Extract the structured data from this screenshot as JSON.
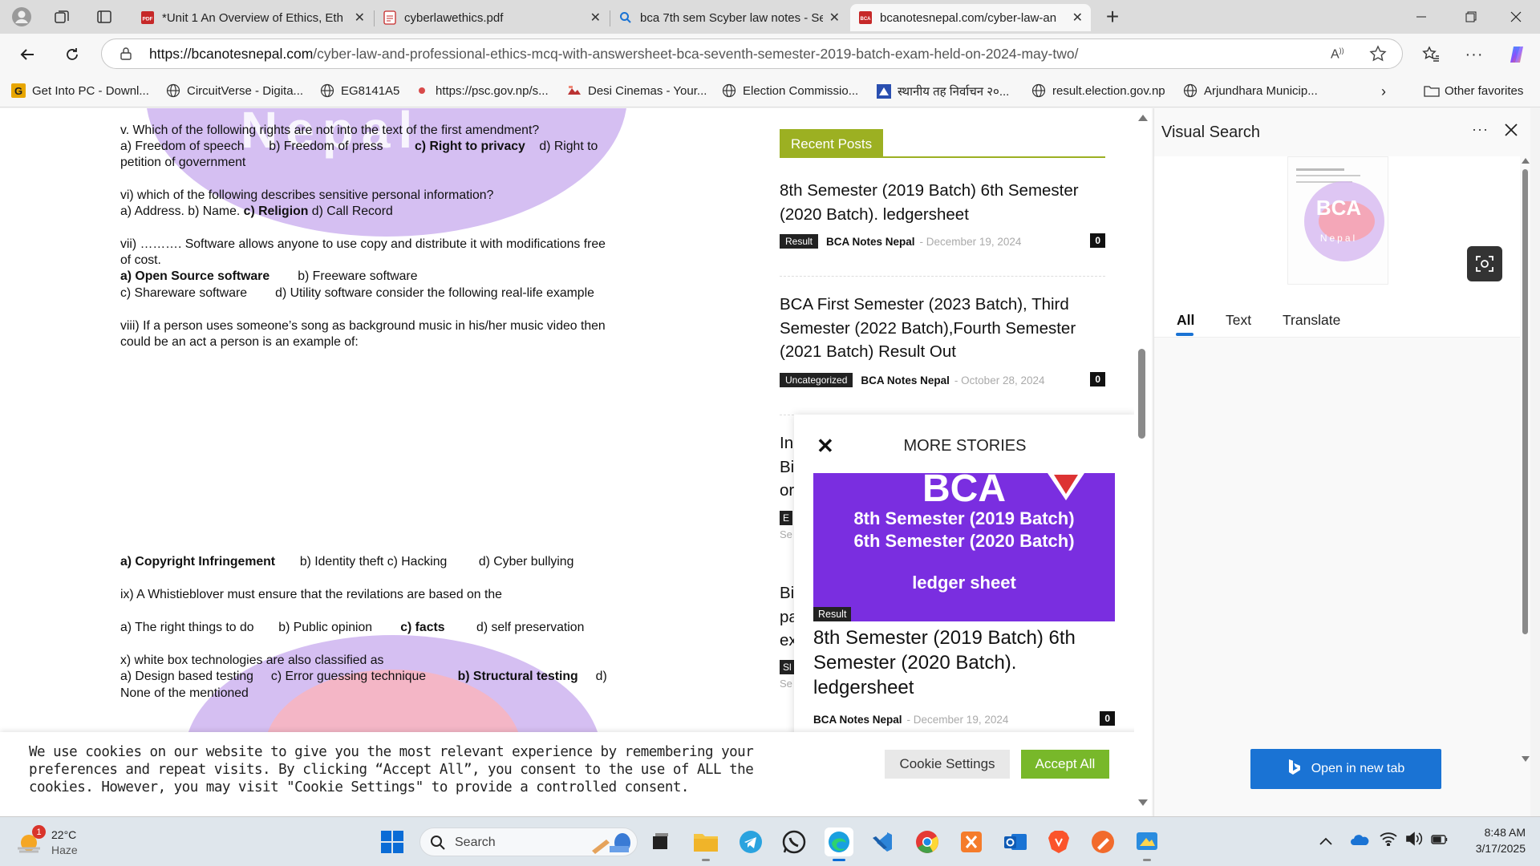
{
  "tabs": [
    {
      "title": "*Unit 1 An Overview of Ethics, Eth",
      "icon": "pdf-icon"
    },
    {
      "title": "cyberlawethics.pdf",
      "icon": "pdf-icon"
    },
    {
      "title": "bca 7th sem Scyber law notes - Se",
      "icon": "search-icon"
    },
    {
      "title": "bcanotesnepal.com/cyber-law-an",
      "icon": "site-icon",
      "active": true
    }
  ],
  "address_bar": {
    "url_domain": "https://bcanotesnepal.com",
    "url_path": "/cyber-law-and-professional-ethics-mcq-with-answersheet-bca-seventh-semester-2019-batch-exam-held-on-2024-may-two/"
  },
  "bookmarks": [
    "Get Into PC - Downl...",
    "CircuitVerse - Digita...",
    "EG8141A5",
    "https://psc.gov.np/s...",
    "Desi Cinemas - Your...",
    "Election Commissio...",
    "स्थानीय तह निर्वाचन २०...",
    "result.election.gov.np",
    "Arjundhara Municip..."
  ],
  "other_favorites": "Other favorites",
  "article": {
    "q5": {
      "q": "v. Which of the following rights are not into the text of the first amendment?",
      "a": "a) Freedom of speech",
      "b": "b) Freedom of press",
      "c": "c) Right to privacy",
      "d": "d) Right to",
      "cont": "petition of government"
    },
    "q6": {
      "q": "vi) which of the following describes sensitive personal information?",
      "a": "a) Address.  b) Name.",
      "c": "c) Religion",
      "d": "d) Call Record"
    },
    "q7": {
      "q": "vii) ………. Software allows anyone to use copy and distribute it with modifications free",
      "cont": "of cost.",
      "a": "a) Open Source software",
      "b": "b) Freeware software",
      "c": "c) Shareware software",
      "d": "d) Utility software consider the following real-life example"
    },
    "q8": {
      "q": "viii) If a person uses someone’s song as background music in his/her music video then",
      "cont": "could be an act a person is an example of:",
      "a": "a) Copyright Infringement",
      "b": "b) Identity theft",
      "c": "c) Hacking",
      "d": "d) Cyber bullying"
    },
    "q9": {
      "q": "ix) A Whistieblover must ensure that the revilations are based on the",
      "a": "a) The right things to do",
      "b": "b) Public opinion",
      "c": "c) facts",
      "d": "d) self preservation"
    },
    "q10": {
      "q": "x) white box technologies are also classified as",
      "a": "a) Design based testing",
      "b": "c) Error guessing technique",
      "c": "b) Structural testing",
      "d": "d)",
      "cont": "None of the mentioned"
    }
  },
  "sidebar": {
    "heading": "Recent Posts",
    "posts": [
      {
        "title": "8th Semester (2019 Batch) 6th Semester (2020 Batch). ledgersheet",
        "category": "Result",
        "author": "BCA Notes Nepal",
        "date": "December 19, 2024",
        "comments": "0"
      },
      {
        "title": "BCA First Semester (2023 Batch), Third Semester (2022 Batch),Fourth Semester (2021 Batch) Result Out",
        "category": "Uncategorized",
        "author": "BCA Notes Nepal",
        "date": "October 28, 2024",
        "comments": "0"
      }
    ],
    "partial": [
      "In",
      "Bi",
      "or",
      "E",
      "Se",
      "Bi",
      "pa",
      "ex",
      "Sl",
      "Se"
    ]
  },
  "more_stories": {
    "heading": "MORE STORIES",
    "image_lines": [
      "BCA",
      "8th Semester (2019 Batch)",
      "6th Semester (2020 Batch)",
      "ledger sheet"
    ],
    "category": "Result",
    "title": "8th Semester (2019 Batch) 6th Semester (2020 Batch). ledgersheet",
    "author": "BCA Notes Nepal",
    "date": "December 19, 2024",
    "comments": "0"
  },
  "cookie": {
    "text": "We use cookies on our website to give you the most relevant experience by remembering your preferences and repeat visits. By clicking “Accept All”, you consent to the use of ALL the cookies. However, you may visit \"Cookie Settings\" to provide a controlled consent.",
    "settings_label": "Cookie Settings",
    "accept_label": "Accept All"
  },
  "visual_search": {
    "title": "Visual Search",
    "tabs": [
      "All",
      "Text",
      "Translate"
    ],
    "thumb_text": [
      "BCA",
      "Nepal"
    ],
    "open_label": "Open in new tab"
  },
  "taskbar": {
    "weather_temp": "22°C",
    "weather_desc": "Haze",
    "weather_badge": "1",
    "search_placeholder": "Search",
    "time": "8:48 AM",
    "date": "3/17/2025"
  },
  "colors": {
    "accent_green": "#9cb022",
    "cookie_green": "#78b82a",
    "bing_blue": "#1a73d4",
    "purple_banner": "#7a2ee0"
  }
}
